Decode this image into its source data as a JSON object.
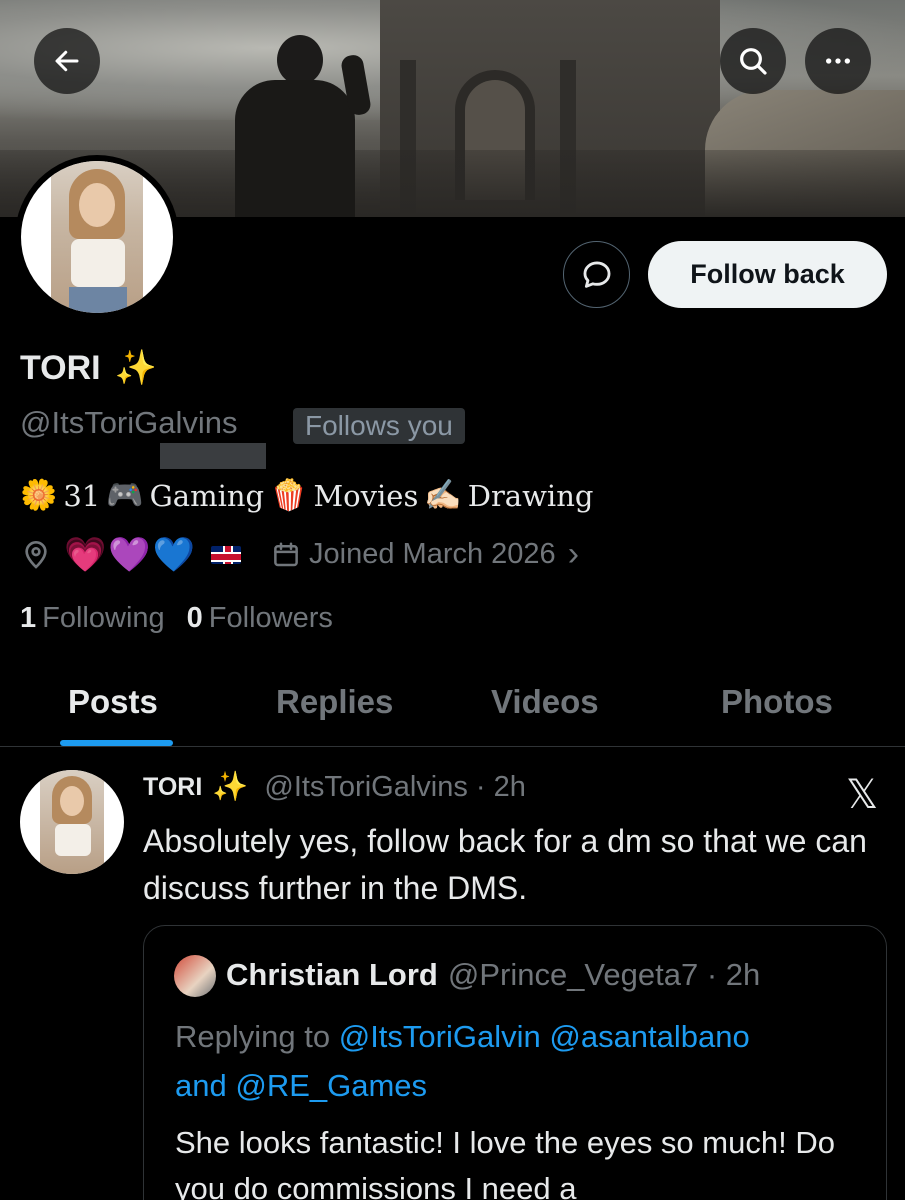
{
  "colors": {
    "accent": "#1d9bf0",
    "background": "#000000",
    "muted": "#71767b",
    "text": "#e7e9ea"
  },
  "header": {
    "back_icon": "arrow-left-icon",
    "search_icon": "search-icon",
    "more_icon": "more-horizontal-icon"
  },
  "profile": {
    "name": "TORI",
    "name_emoji": "✨",
    "handle": "@ItsToriGalvins",
    "follows_you": "Follows you",
    "dm_icon": "message-bubble-icon",
    "follow_back_label": "Follow back",
    "bio": {
      "e1": "🌼",
      "t1": "31",
      "e2": "🎮",
      "t2": "Gaming",
      "e3": "🍿",
      "t3": "Movies",
      "e4": "✍🏻",
      "t4": "Drawing"
    },
    "location_icon": "location-pin-icon",
    "location_hearts": [
      "💗",
      "💜",
      "💙"
    ],
    "location_flag": "uk-flag",
    "calendar_icon": "calendar-icon",
    "joined": "Joined March 2026",
    "joined_chevron": "›",
    "following_count": "1",
    "following_label": "Following",
    "followers_count": "0",
    "followers_label": "Followers"
  },
  "tabs": [
    {
      "label": "Posts",
      "active": true
    },
    {
      "label": "Replies",
      "active": false
    },
    {
      "label": "Videos",
      "active": false
    },
    {
      "label": "Photos",
      "active": false
    }
  ],
  "post": {
    "name": "TORI",
    "name_emoji": "✨",
    "handle_time": "@ItsToriGalvins · 2h",
    "x_logo": "𝕏",
    "text": "Absolutely yes, follow back for a dm so that we can discuss further in the DMS.",
    "quote": {
      "name": "Christian Lord",
      "handle_time": "@Prince_Vegeta7 · 2h",
      "replying_prefix": "Replying to",
      "replying_to_1": "@ItsToriGalvin",
      "replying_to_2": "@asantalbano",
      "replying_and": "and",
      "replying_to_3": "@RE_Games",
      "text": "She looks fantastic! I love the eyes so much! Do you do commissions I need a"
    }
  }
}
